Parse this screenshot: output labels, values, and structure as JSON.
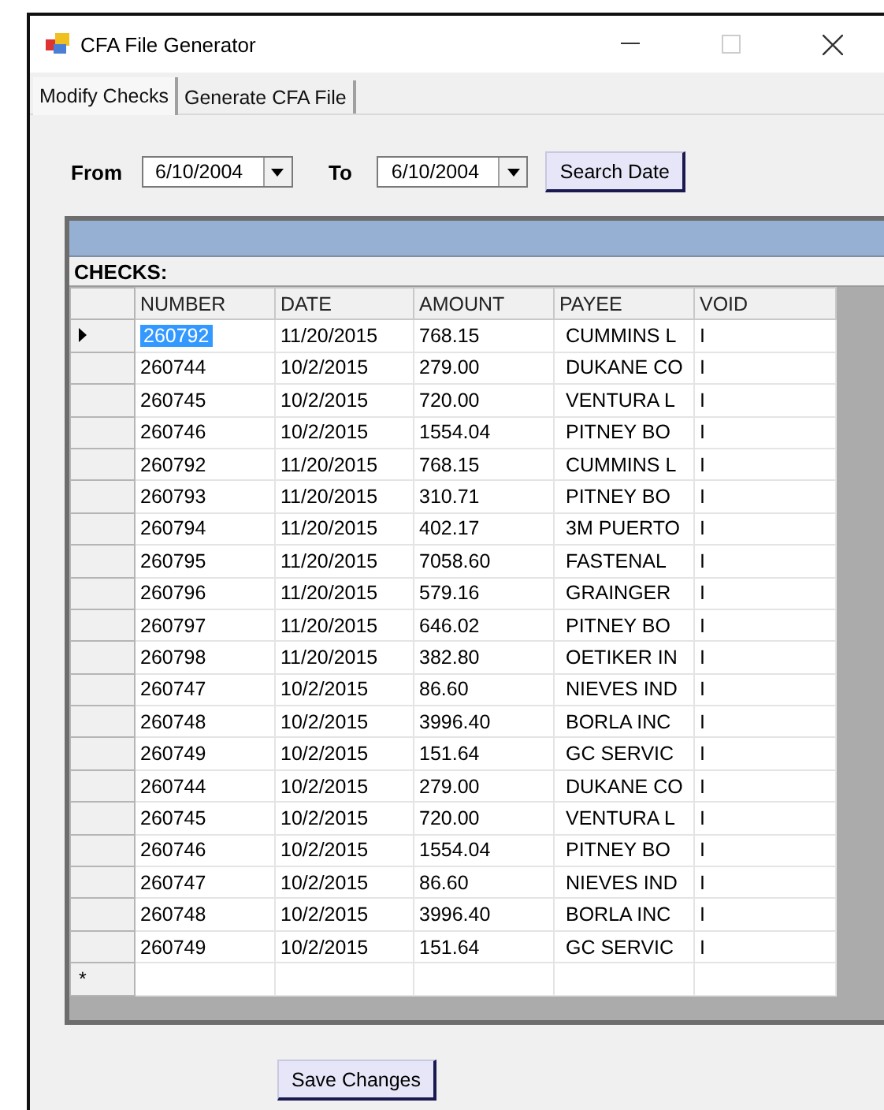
{
  "window": {
    "title": "CFA File Generator"
  },
  "tabs": [
    {
      "label": "Modify Checks",
      "selected": true
    },
    {
      "label": "Generate CFA File",
      "selected": false
    }
  ],
  "filter": {
    "from_label": "From",
    "from_value": "6/10/2004",
    "to_label": "To",
    "to_value": "6/10/2004",
    "button": "Search Date"
  },
  "grid": {
    "caption": "CHECKS:",
    "columns": [
      "NUMBER",
      "DATE",
      "AMOUNT",
      "PAYEE",
      "VOID"
    ],
    "new_row_marker": "*",
    "rows": [
      {
        "cells": [
          "260792",
          "11/20/2015",
          "768.15",
          "CUMMINS L",
          "I"
        ],
        "selected": true
      },
      {
        "cells": [
          "260744",
          "10/2/2015",
          "279.00",
          "DUKANE CO",
          "I"
        ],
        "selected": false
      },
      {
        "cells": [
          "260745",
          "10/2/2015",
          "720.00",
          "VENTURA L",
          "I"
        ],
        "selected": false
      },
      {
        "cells": [
          "260746",
          "10/2/2015",
          "1554.04",
          "PITNEY BO",
          "I"
        ],
        "selected": false
      },
      {
        "cells": [
          "260792",
          "11/20/2015",
          "768.15",
          "CUMMINS L",
          "I"
        ],
        "selected": false
      },
      {
        "cells": [
          "260793",
          "11/20/2015",
          "310.71",
          "PITNEY BO",
          "I"
        ],
        "selected": false
      },
      {
        "cells": [
          "260794",
          "11/20/2015",
          "402.17",
          "3M PUERTO",
          "I"
        ],
        "selected": false
      },
      {
        "cells": [
          "260795",
          "11/20/2015",
          "7058.60",
          "FASTENAL",
          "I"
        ],
        "selected": false
      },
      {
        "cells": [
          "260796",
          "11/20/2015",
          "579.16",
          "GRAINGER",
          "I"
        ],
        "selected": false
      },
      {
        "cells": [
          "260797",
          "11/20/2015",
          "646.02",
          "PITNEY BO",
          "I"
        ],
        "selected": false
      },
      {
        "cells": [
          "260798",
          "11/20/2015",
          "382.80",
          "OETIKER IN",
          "I"
        ],
        "selected": false
      },
      {
        "cells": [
          "260747",
          "10/2/2015",
          "86.60",
          "NIEVES IND",
          "I"
        ],
        "selected": false
      },
      {
        "cells": [
          "260748",
          "10/2/2015",
          "3996.40",
          "BORLA INC",
          "I"
        ],
        "selected": false
      },
      {
        "cells": [
          "260749",
          "10/2/2015",
          "151.64",
          "GC SERVIC",
          "I"
        ],
        "selected": false
      },
      {
        "cells": [
          "260744",
          "10/2/2015",
          "279.00",
          "DUKANE CO",
          "I"
        ],
        "selected": false
      },
      {
        "cells": [
          "260745",
          "10/2/2015",
          "720.00",
          "VENTURA L",
          "I"
        ],
        "selected": false
      },
      {
        "cells": [
          "260746",
          "10/2/2015",
          "1554.04",
          "PITNEY BO",
          "I"
        ],
        "selected": false
      },
      {
        "cells": [
          "260747",
          "10/2/2015",
          "86.60",
          "NIEVES IND",
          "I"
        ],
        "selected": false
      },
      {
        "cells": [
          "260748",
          "10/2/2015",
          "3996.40",
          "BORLA INC",
          "I"
        ],
        "selected": false
      },
      {
        "cells": [
          "260749",
          "10/2/2015",
          "151.64",
          "GC SERVIC",
          "I"
        ],
        "selected": false
      }
    ]
  },
  "save_button": "Save Changes"
}
